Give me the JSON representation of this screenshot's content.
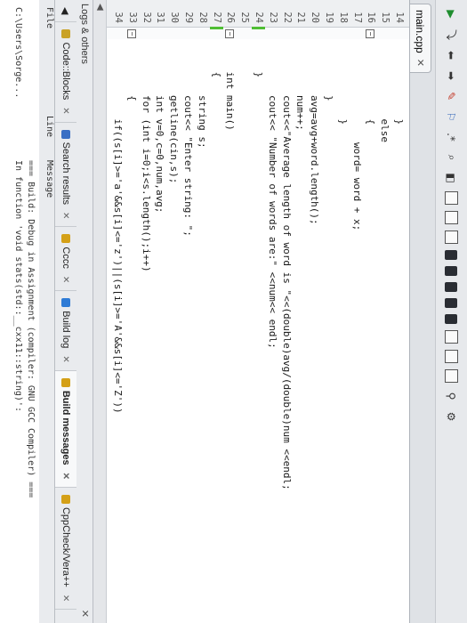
{
  "editor_tab": {
    "label": "main.cpp",
    "close": "✕"
  },
  "code_lines": [
    {
      "n": "14",
      "text": "            }"
    },
    {
      "n": "15",
      "text": "            else"
    },
    {
      "n": "16",
      "text": "            {"
    },
    {
      "n": "17",
      "text": "                word= word + x;"
    },
    {
      "n": "18",
      "text": "            }"
    },
    {
      "n": "19",
      "text": "        }"
    },
    {
      "n": "20",
      "text": "        avg=avg+word.length();"
    },
    {
      "n": "21",
      "text": "        num++;"
    },
    {
      "n": "22",
      "text": "        cout<<\"Average length of word is \"<<(double)avg/(double)num <<endl;"
    },
    {
      "n": "23",
      "text": "        cout<< \"Number of words are:\" <<num<< endl;"
    },
    {
      "n": "24",
      "text": "    }"
    },
    {
      "n": "25",
      "text": ""
    },
    {
      "n": "26",
      "text": "    int main()"
    },
    {
      "n": "27",
      "text": "    {"
    },
    {
      "n": "28",
      "text": "        string s;"
    },
    {
      "n": "29",
      "text": "        cout<< \"Enter string: \";"
    },
    {
      "n": "30",
      "text": "        getline(cin,s);"
    },
    {
      "n": "31",
      "text": "        int v=0,c=0,num,avg;"
    },
    {
      "n": "32",
      "text": "        for (int i=0;i<s.length();i++)"
    },
    {
      "n": "33",
      "text": "        {"
    },
    {
      "n": "34",
      "text": "            if((s[i]>='a'&&s[i]<='z')||(s[i]>='A'&&s[i]<='Z'))"
    }
  ],
  "logs": {
    "title": "Logs & others",
    "tabs": [
      {
        "label": "Code::Blocks",
        "color": "#c9a227"
      },
      {
        "label": "Search results",
        "color": "#3a6fc4"
      },
      {
        "label": "Cccc",
        "color": "#d4a017"
      },
      {
        "label": "Build log",
        "color": "#2e7bd6"
      },
      {
        "label": "Build messages",
        "color": "#d4a017"
      },
      {
        "label": "CppCheck/Vera++",
        "color": "#d4a017"
      }
    ],
    "columns": {
      "file": "File",
      "line": "Line",
      "message": "Message"
    },
    "rows": [
      {
        "file": "",
        "line": "",
        "message": "=== Build: Debug in Assignment (compiler: GNU GCC Compiler) ==="
      },
      {
        "file": "C:\\Users\\Sorge...",
        "line": "",
        "message": "In function 'void stats(std::__cxx11::string)':"
      }
    ]
  }
}
